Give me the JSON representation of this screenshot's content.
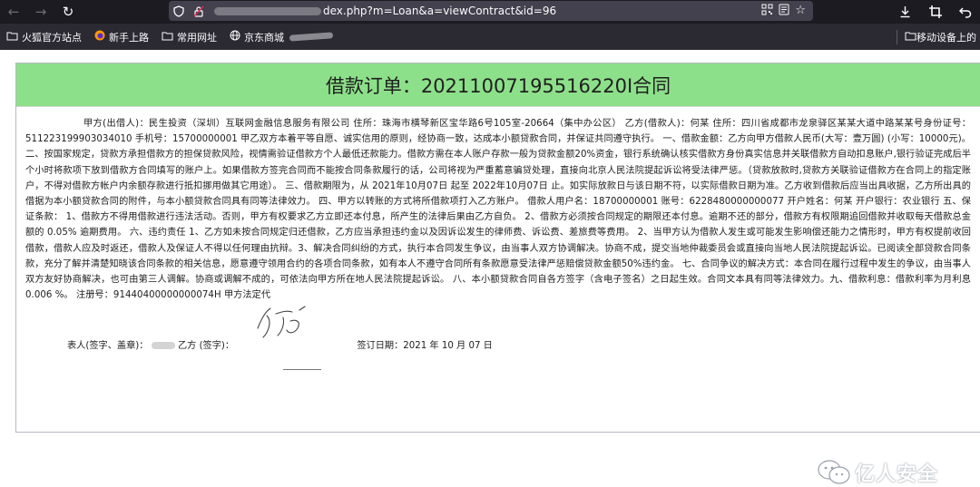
{
  "browser": {
    "url_prefix": "",
    "url_visible": "dex.php?m=Loan&a=viewContract&id=96",
    "bookmarks": [
      "火狐官方站点",
      "新手上路",
      "常用网址",
      "京东商城"
    ],
    "bookmark_right": "移动设备上的"
  },
  "contract": {
    "title": "借款订单：20211007195516220I合同",
    "body": "甲方(出借人)：民生投资（深圳）互联网金融信息服务有限公司        住所：珠海市横琴新区宝华路6号105室-20664（集中办公区）        乙方(借款人)：何某        住所：四川省成都市龙泉驿区某某大道中路某某号身份证号：511223199903034010 手机号：15700000001        甲乙双方本着平等自愿、诚实信用的原则，经协商一致，达成本小额贷款合同，并保证共同遵守执行。        一、借款金额：乙方向甲方借款人民币(大写：壹万圆) (小写：10000元)。        二、按国家规定，贷款方承担借款方的担保贷款风险，视情需验证借款方个人最低还款能力。借款方需在本人账户存款一般为贷款金额20%资金，银行系统确认核实借款方身份真实信息并关联借款方自动扣息账户,银行验证完成后半个小时将款项下放到借款方合同填写的账户上。如果借款方签完合同而不能按合同条款履行的话，公司将视为严重蓄意骗贷处理，直接向北京人民法院提起诉讼将受法律严惩。（贷款放款时,贷款方关联验证借款方在合同上的指定账户，不得对借款方帐户内余额存款进行抵扣挪用做其它用途）。        三、借款期限为，从 2021年10月07日 起至 2022年10月07日 止。如实际放款日与该日期不符，以实际借款日期为准。乙方收到借款后应当出具收据，乙方所出具的借据为本小额贷款合同的附件，与本小额贷款合同具有同等法律效力。        四、甲方以转账的方式将所借款项打入乙方账户。        借款人用户名：18700000001        账号：6228480000000077 开户姓名：何某        开户银行：农业银行        五、保证条款：        1、借款方不得用借款进行违法活动。否则，甲方有权要求乙方立即还本付息，所产生的法律后果由乙方自负。        2、借款方必须按合同规定的期限还本付息。逾期不还的部分，借款方有权限期追回借款并收取每天借款总金额的 0.05% 逾期费用。        六、违约责任        1、乙方如未按合同规定归还借款，乙方应当承担违约金以及因诉讼发生的律师费、诉讼费、差旅费等费用。        2、当甲方认为借款人发生或可能发生影响偿还能力之情形时，甲方有权提前收回借款，借款人应及时返还，借款人及保证人不得以任何理由抗辩。3、解决合同纠纷的方式，执行本合同发生争议，由当事人双方协调解决。协商不成，提交当地仲裁委员会或直接向当地人民法院提起诉讼。已阅读全部贷款合同条款，充分了解并清楚知晓该合同条款的相关信息，愿意遵守领用合约的各项合同条款，如有本人不遵守合同所有条款愿意受法律严惩赔偿贷款金额50%违约金。        七、合同争议的解决方式：本合同在履行过程中发生的争议，由当事人双方友好协商解决，也可由第三人调解。协商或调解不成的，可依法向甲方所在地人民法院提起诉讼。        八、本小额贷款合同自各方签字（含电子签名）之日起生效。合同文本具有同等法律效力。九、借款利息：借款利率为月利息 0.006 %。        注册号：91440400000000074H        甲方法定代",
    "sign_left": "表人(签字、盖章)：",
    "sign_party_b": "乙方 (签字)：",
    "sign_date": "签订日期：2021 年 10 月 07 日"
  },
  "watermark": {
    "text": "亿人安全"
  }
}
